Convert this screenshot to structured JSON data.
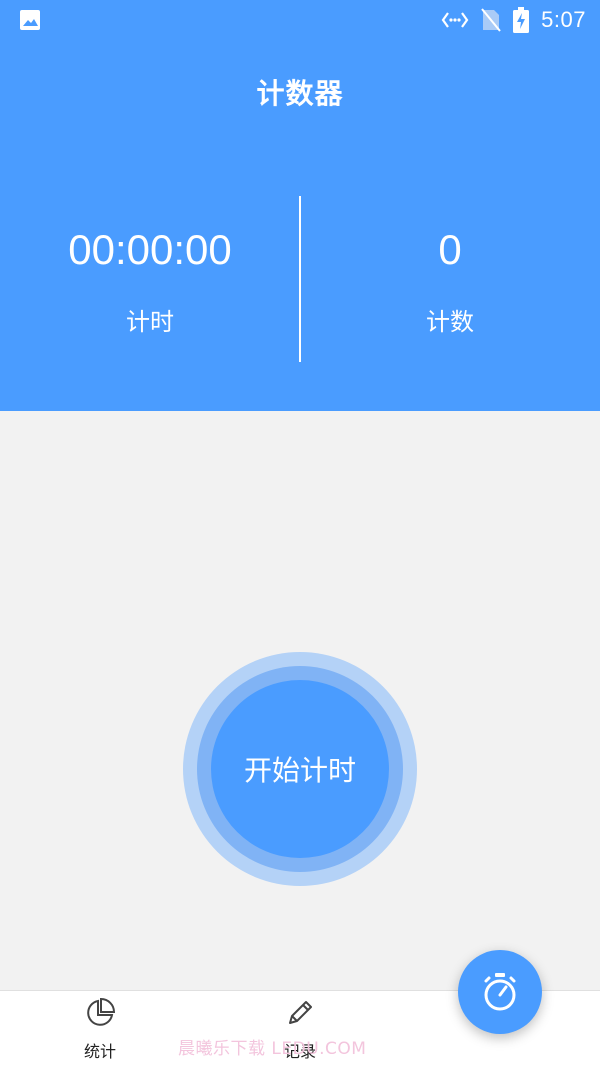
{
  "status_bar": {
    "time": "5:07",
    "icons": [
      "image-icon",
      "data-transfer-icon",
      "no-sim-icon",
      "battery-charging-icon"
    ]
  },
  "header": {
    "title": "计数器",
    "timer": {
      "value": "00:00:00",
      "label": "计时"
    },
    "count": {
      "value": "0",
      "label": "计数"
    }
  },
  "main": {
    "start_button_label": "开始计时"
  },
  "bottom_nav": {
    "items": [
      {
        "label": "统计",
        "icon": "pie-chart-icon"
      },
      {
        "label": "记录",
        "icon": "pencil-icon"
      }
    ]
  },
  "fab": {
    "icon": "stopwatch-icon"
  },
  "watermark": "晨曦乐下载 LEDU.COM",
  "colors": {
    "primary": "#4a9cff",
    "background": "#f2f2f2",
    "ring_outer": "#b4d2f7",
    "ring_mid": "#80b3f5"
  }
}
